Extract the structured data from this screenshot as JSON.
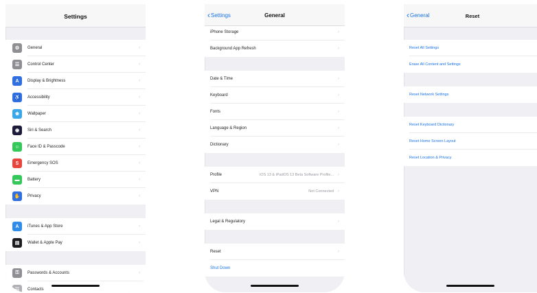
{
  "screen1": {
    "title": "Settings",
    "groups": [
      [
        {
          "label": "General",
          "icon": "gear-icon",
          "color": "#8e8e93",
          "glyph": "⚙"
        },
        {
          "label": "Control Center",
          "icon": "control-center-icon",
          "color": "#8e8e93",
          "glyph": "☰"
        },
        {
          "label": "Display & Brightness",
          "icon": "display-icon",
          "color": "#2f6fe0",
          "glyph": "A"
        },
        {
          "label": "Accessibility",
          "icon": "accessibility-icon",
          "color": "#2f6fe0",
          "glyph": "♿"
        },
        {
          "label": "Wallpaper",
          "icon": "wallpaper-icon",
          "color": "#3aa8e8",
          "glyph": "❀"
        },
        {
          "label": "Siri & Search",
          "icon": "siri-icon",
          "color": "#1c1c3a",
          "glyph": "◉"
        },
        {
          "label": "Face ID & Passcode",
          "icon": "face-id-icon",
          "color": "#34c759",
          "glyph": "☺"
        },
        {
          "label": "Emergency SOS",
          "icon": "sos-icon",
          "color": "#e8453c",
          "glyph": "S"
        },
        {
          "label": "Battery",
          "icon": "battery-icon",
          "color": "#34c759",
          "glyph": "▬"
        },
        {
          "label": "Privacy",
          "icon": "privacy-icon",
          "color": "#2f6fe0",
          "glyph": "✋"
        }
      ],
      [
        {
          "label": "iTunes & App Store",
          "icon": "app-store-icon",
          "color": "#2f8ce8",
          "glyph": "A"
        },
        {
          "label": "Wallet & Apple Pay",
          "icon": "wallet-icon",
          "color": "#1c1c1e",
          "glyph": "▤"
        }
      ],
      [
        {
          "label": "Passwords & Accounts",
          "icon": "key-icon",
          "color": "#8e8e93",
          "glyph": "⚿"
        },
        {
          "label": "Contacts",
          "icon": "contacts-icon",
          "color": "#b0b0b5",
          "glyph": "☷"
        }
      ]
    ]
  },
  "screen2": {
    "back": "Settings",
    "title": "General",
    "groups": [
      [
        {
          "label": "iPhone Storage"
        },
        {
          "label": "Background App Refresh"
        }
      ],
      [
        {
          "label": "Date & Time"
        },
        {
          "label": "Keyboard"
        },
        {
          "label": "Fonts"
        },
        {
          "label": "Language & Region"
        },
        {
          "label": "Dictionary"
        }
      ],
      [
        {
          "label": "Profile",
          "detail": "iOS 13 & iPadOS 13 Beta Software Profile..."
        },
        {
          "label": "VPN",
          "detail": "Not Connected"
        }
      ],
      [
        {
          "label": "Legal & Regulatory"
        }
      ],
      [
        {
          "label": "Reset"
        },
        {
          "label": "Shut Down",
          "blue": true
        }
      ]
    ]
  },
  "screen3": {
    "back": "General",
    "title": "Reset",
    "groups": [
      [
        {
          "label": "Reset All Settings"
        },
        {
          "label": "Erase All Content and Settings"
        }
      ],
      [
        {
          "label": "Reset Network Settings"
        }
      ],
      [
        {
          "label": "Reset Keyboard Dictionary"
        },
        {
          "label": "Reset Home Screen Layout"
        },
        {
          "label": "Reset Location & Privacy"
        }
      ]
    ]
  }
}
